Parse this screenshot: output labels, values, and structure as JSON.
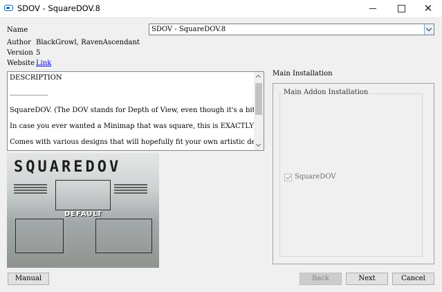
{
  "window": {
    "title": "SDOV - SquareDOV.8",
    "close_glyph": "✕"
  },
  "fields": {
    "name_label": "Name",
    "name_value": "SDOV - SquareDOV.8",
    "author_label": "Author",
    "author_value": "BlackGrowl, RavenAscendant",
    "version_label": "Version",
    "version_value": "5",
    "website_label": "Website",
    "website_value": "Link"
  },
  "description": {
    "lines": [
      "DESCRIPTION",
      "___________",
      "SquareDOV. (The DOV stands for Depth of View, even though it's a bit nonsensical still)",
      "In case you ever wanted a Minimap that was square, this is EXACTLY for you.",
      "Comes with various designs that will hopefully fit your own artistic designs in many ways."
    ]
  },
  "preview": {
    "title": "SQUAREDOV",
    "labels": {
      "default": "DEFAULT"
    }
  },
  "installation": {
    "group_title": "Main Installation",
    "subgroup_title": "Main Addon Installation",
    "option_label": "SquareDOV",
    "option_checked": true
  },
  "buttons": {
    "manual": "Manual",
    "back": "Back",
    "next": "Next",
    "cancel": "Cancel"
  },
  "icons": {
    "app": "app-icon",
    "minimize": "minimize-icon",
    "maximize": "maximize-icon",
    "close": "close-icon",
    "dropdown": "chevron-down-icon",
    "scroll_up": "scroll-up-icon",
    "scroll_down": "scroll-down-icon",
    "checkbox": "checkbox-checked-icon"
  },
  "colors": {
    "link": "#0000ee",
    "accent": "#1565c0",
    "dropdown_border": "#7aa6d8"
  }
}
